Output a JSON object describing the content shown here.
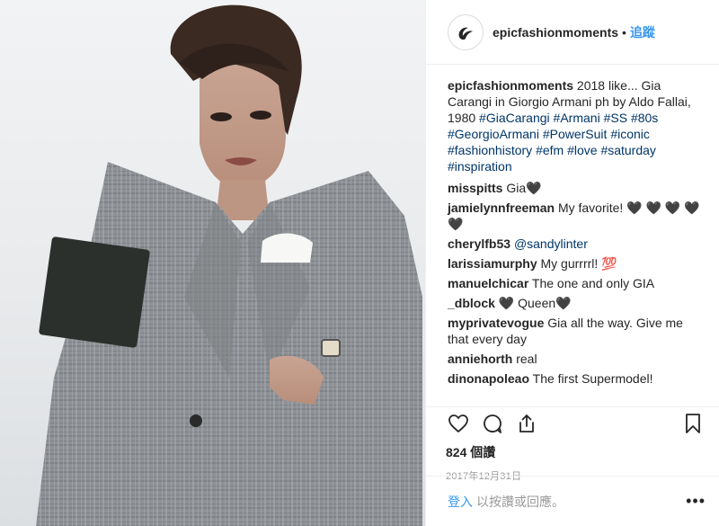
{
  "post": {
    "username": "epicfashionmoments",
    "separator": "•",
    "follow_label": "追蹤",
    "caption_text": "2018 like... Gia Carangi in Giorgio Armani ph by Aldo Fallai, 1980",
    "hashtags": [
      "#GiaCarangi",
      "#Armani",
      "#SS",
      "#80s",
      "#GeorgioArmani",
      "#PowerSuit",
      "#iconic",
      "#fashionhistory",
      "#efm",
      "#love",
      "#saturday",
      "#inspiration"
    ],
    "likes": "824 個讚",
    "date": "2017年12月31日"
  },
  "comments": [
    {
      "user": "misspitts",
      "text": "Gia🖤"
    },
    {
      "user": "jamielynnfreeman",
      "text": "My favorite! 🖤 🖤 🖤 🖤 🖤"
    },
    {
      "user": "cherylfb53",
      "mention": "@sandylinter",
      "text": ""
    },
    {
      "user": "larissiamurphy",
      "text": "My gurrrrl! 💯"
    },
    {
      "user": "manuelchicar",
      "text": "The one and only GIA"
    },
    {
      "user": "_dblock",
      "text": "🖤 Queen🖤"
    },
    {
      "user": "myprivatevogue",
      "text": "Gia all the way. Give me that every day"
    },
    {
      "user": "anniehorth",
      "text": "real"
    },
    {
      "user": "dinonapoleao",
      "text": "The first Supermodel!"
    }
  ],
  "login_bar": {
    "login_label": "登入",
    "rest_text": "以按讚或回應。",
    "more_label": "•••"
  },
  "icons": {
    "like": "heart-icon",
    "comment": "comment-icon",
    "share": "share-icon",
    "save": "bookmark-icon",
    "avatar": "efm-logo"
  },
  "colors": {
    "link": "#3897f0",
    "hashtag": "#003569",
    "muted": "#999999",
    "border": "#efefef"
  }
}
